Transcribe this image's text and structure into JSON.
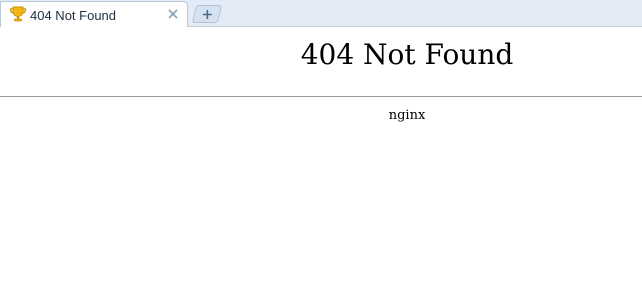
{
  "browser": {
    "tab": {
      "title": "404 Not Found",
      "favicon": "trophy-icon",
      "close_icon": "close-icon"
    },
    "new_tab_icon": "plus-icon"
  },
  "page": {
    "heading": "404 Not Found",
    "server": "nginx"
  },
  "colors": {
    "tabbar_bg": "#e3ecf6",
    "favicon": "#f2b712",
    "close": "#8aa0b8"
  }
}
